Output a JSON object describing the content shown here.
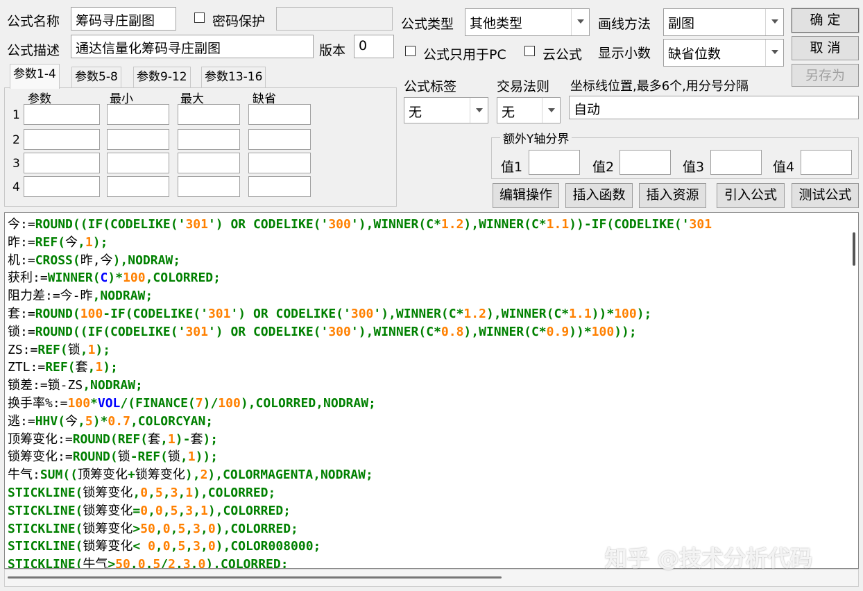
{
  "form": {
    "name_label": "公式名称",
    "name_value": "筹码寻庄副图",
    "password_label": "密码保护",
    "password_value": "",
    "desc_label": "公式描述",
    "desc_value": "通达信量化筹码寻庄副图",
    "version_label": "版本",
    "version_value": "0",
    "type_label": "公式类型",
    "type_value": "其他类型",
    "draw_label": "画线方法",
    "draw_value": "副图",
    "pc_only_label": "公式只用于PC",
    "cloud_label": "云公式",
    "decimals_label": "显示小数",
    "decimals_value": "缺省位数",
    "tag_label": "公式标签",
    "tag_value": "无",
    "trade_label": "交易法则",
    "trade_value": "无",
    "axis_label": "坐标线位置,最多6个,用分号分隔",
    "axis_value": "自动",
    "extra_y_label": "额外Y轴分界",
    "val1": "值1",
    "val2": "值2",
    "val3": "值3",
    "val4": "值4"
  },
  "buttons": {
    "ok": "确  定",
    "cancel": "取  消",
    "save_as": "另存为",
    "edit_ops": "编辑操作",
    "insert_func": "插入函数",
    "insert_res": "插入资源",
    "import_formula": "引入公式",
    "test_formula": "测试公式"
  },
  "tabs": [
    "参数1-4",
    "参数5-8",
    "参数9-12",
    "参数13-16"
  ],
  "param_headers": {
    "param": "参数",
    "min": "最小",
    "max": "最大",
    "default": "缺省"
  },
  "param_rows": [
    "1",
    "2",
    "3",
    "4"
  ],
  "colors": {
    "black": "#000000",
    "green": "#008000",
    "orange": "#ff8000",
    "blue": "#0000ff"
  },
  "code_lines": [
    [
      [
        "今:=",
        "black"
      ],
      [
        "ROUND((IF(CODELIKE('",
        "green"
      ],
      [
        "301",
        "orange"
      ],
      [
        "') OR CODELIKE('",
        "green"
      ],
      [
        "300",
        "orange"
      ],
      [
        "'),WINNER(C*",
        "green"
      ],
      [
        "1.2",
        "orange"
      ],
      [
        "),WINNER(C*",
        "green"
      ],
      [
        "1.1",
        "orange"
      ],
      [
        "))-IF(CODELIKE('",
        "green"
      ],
      [
        "301",
        "orange"
      ]
    ],
    [
      [
        "昨:=",
        "black"
      ],
      [
        "REF(",
        "green"
      ],
      [
        "今",
        "black"
      ],
      [
        ",",
        "green"
      ],
      [
        "1",
        "orange"
      ],
      [
        ");",
        "green"
      ]
    ],
    [
      [
        "机:=",
        "black"
      ],
      [
        "CROSS(",
        "green"
      ],
      [
        "昨,今",
        "black"
      ],
      [
        "),NODRAW;",
        "green"
      ]
    ],
    [
      [
        "获利:=",
        "black"
      ],
      [
        "WINNER(",
        "green"
      ],
      [
        "C",
        "blue"
      ],
      [
        ")*",
        "green"
      ],
      [
        "100",
        "orange"
      ],
      [
        ",COLORRED;",
        "green"
      ]
    ],
    [
      [
        "阻力差:=今-昨",
        "black"
      ],
      [
        ",NODRAW;",
        "green"
      ]
    ],
    [
      [
        "套:=",
        "black"
      ],
      [
        "ROUND(",
        "green"
      ],
      [
        "100",
        "orange"
      ],
      [
        "-IF(CODELIKE('",
        "green"
      ],
      [
        "301",
        "orange"
      ],
      [
        "') OR CODELIKE('",
        "green"
      ],
      [
        "300",
        "orange"
      ],
      [
        "'),WINNER(C*",
        "green"
      ],
      [
        "1.2",
        "orange"
      ],
      [
        "),WINNER(C*",
        "green"
      ],
      [
        "1.1",
        "orange"
      ],
      [
        "))*",
        "green"
      ],
      [
        "100",
        "orange"
      ],
      [
        ");",
        "green"
      ]
    ],
    [
      [
        "锁:=",
        "black"
      ],
      [
        "ROUND((IF(CODELIKE('",
        "green"
      ],
      [
        "301",
        "orange"
      ],
      [
        "') OR CODELIKE('",
        "green"
      ],
      [
        "300",
        "orange"
      ],
      [
        "'),WINNER(C*",
        "green"
      ],
      [
        "0.8",
        "orange"
      ],
      [
        "),WINNER(C*",
        "green"
      ],
      [
        "0.9",
        "orange"
      ],
      [
        "))*",
        "green"
      ],
      [
        "100",
        "orange"
      ],
      [
        "));",
        "green"
      ]
    ],
    [
      [
        "ZS:=",
        "black"
      ],
      [
        "REF(",
        "green"
      ],
      [
        "锁",
        "black"
      ],
      [
        ",",
        "green"
      ],
      [
        "1",
        "orange"
      ],
      [
        ");",
        "green"
      ]
    ],
    [
      [
        "ZTL:=",
        "black"
      ],
      [
        "REF(",
        "green"
      ],
      [
        "套",
        "black"
      ],
      [
        ",",
        "green"
      ],
      [
        "1",
        "orange"
      ],
      [
        ");",
        "green"
      ]
    ],
    [
      [
        "锁差:=锁-ZS",
        "black"
      ],
      [
        ",NODRAW;",
        "green"
      ]
    ],
    [
      [
        "换手率%:=",
        "black"
      ],
      [
        "100",
        "orange"
      ],
      [
        "*",
        "green"
      ],
      [
        "VOL",
        "blue"
      ],
      [
        "/(FINANCE(",
        "green"
      ],
      [
        "7",
        "orange"
      ],
      [
        ")/",
        "green"
      ],
      [
        "100",
        "orange"
      ],
      [
        "),COLORRED,NODRAW;",
        "green"
      ]
    ],
    [
      [
        "逃:=",
        "black"
      ],
      [
        "HHV(",
        "green"
      ],
      [
        "今",
        "black"
      ],
      [
        ",",
        "green"
      ],
      [
        "5",
        "orange"
      ],
      [
        ")*",
        "green"
      ],
      [
        "0.7",
        "orange"
      ],
      [
        ",COLORCYAN;",
        "green"
      ]
    ],
    [
      [
        "顶筹变化:=",
        "black"
      ],
      [
        "ROUND(REF(",
        "green"
      ],
      [
        "套",
        "black"
      ],
      [
        ",",
        "green"
      ],
      [
        "1",
        "orange"
      ],
      [
        ")-",
        "green"
      ],
      [
        "套",
        "black"
      ],
      [
        ");",
        "green"
      ]
    ],
    [
      [
        "锁筹变化:=",
        "black"
      ],
      [
        "ROUND(",
        "green"
      ],
      [
        "锁",
        "black"
      ],
      [
        "-REF(",
        "green"
      ],
      [
        "锁",
        "black"
      ],
      [
        ",",
        "green"
      ],
      [
        "1",
        "orange"
      ],
      [
        "));",
        "green"
      ]
    ],
    [
      [
        "牛气:",
        "black"
      ],
      [
        "SUM((",
        "green"
      ],
      [
        "顶筹变化",
        "black"
      ],
      [
        "+",
        "green"
      ],
      [
        "锁筹变化",
        "black"
      ],
      [
        "),",
        "green"
      ],
      [
        "2",
        "orange"
      ],
      [
        "),COLORMAGENTA,NODRAW;",
        "green"
      ]
    ],
    [
      [
        "STICKLINE(",
        "green"
      ],
      [
        "锁筹变化",
        "black"
      ],
      [
        ",",
        "green"
      ],
      [
        "0",
        "orange"
      ],
      [
        ",",
        "green"
      ],
      [
        "5",
        "orange"
      ],
      [
        ",",
        "green"
      ],
      [
        "3",
        "orange"
      ],
      [
        ",",
        "green"
      ],
      [
        "1",
        "orange"
      ],
      [
        "),COLORRED;",
        "green"
      ]
    ],
    [
      [
        "STICKLINE(",
        "green"
      ],
      [
        "锁筹变化",
        "black"
      ],
      [
        "=",
        "green"
      ],
      [
        "0",
        "orange"
      ],
      [
        ",",
        "green"
      ],
      [
        "0",
        "orange"
      ],
      [
        ",",
        "green"
      ],
      [
        "5",
        "orange"
      ],
      [
        ",",
        "green"
      ],
      [
        "3",
        "orange"
      ],
      [
        ",",
        "green"
      ],
      [
        "1",
        "orange"
      ],
      [
        "),COLORRED;",
        "green"
      ]
    ],
    [
      [
        "STICKLINE(",
        "green"
      ],
      [
        "锁筹变化",
        "black"
      ],
      [
        ">",
        "green"
      ],
      [
        "50",
        "orange"
      ],
      [
        ",",
        "green"
      ],
      [
        "0",
        "orange"
      ],
      [
        ",",
        "green"
      ],
      [
        "5",
        "orange"
      ],
      [
        ",",
        "green"
      ],
      [
        "3",
        "orange"
      ],
      [
        ",",
        "green"
      ],
      [
        "0",
        "orange"
      ],
      [
        "),COLORRED;",
        "green"
      ]
    ],
    [
      [
        "STICKLINE(",
        "green"
      ],
      [
        "锁筹变化",
        "black"
      ],
      [
        "< ",
        "green"
      ],
      [
        "0",
        "orange"
      ],
      [
        ",",
        "green"
      ],
      [
        "0",
        "orange"
      ],
      [
        ",",
        "green"
      ],
      [
        "5",
        "orange"
      ],
      [
        ",",
        "green"
      ],
      [
        "3",
        "orange"
      ],
      [
        ",",
        "green"
      ],
      [
        "0",
        "orange"
      ],
      [
        "),COLOR008000;",
        "green"
      ]
    ],
    [
      [
        "STICKLINE(",
        "green"
      ],
      [
        "牛气",
        "black"
      ],
      [
        ">",
        "green"
      ],
      [
        "50",
        "orange"
      ],
      [
        ".",
        "green"
      ],
      [
        "0",
        "orange"
      ],
      [
        ".",
        "green"
      ],
      [
        "5",
        "orange"
      ],
      [
        "/",
        "green"
      ],
      [
        "2",
        "orange"
      ],
      [
        ".",
        "green"
      ],
      [
        "3",
        "orange"
      ],
      [
        ".",
        "green"
      ],
      [
        "0",
        "orange"
      ],
      [
        "),COLORRED;",
        "green"
      ]
    ]
  ],
  "watermark": "知乎 @技术分析代码"
}
